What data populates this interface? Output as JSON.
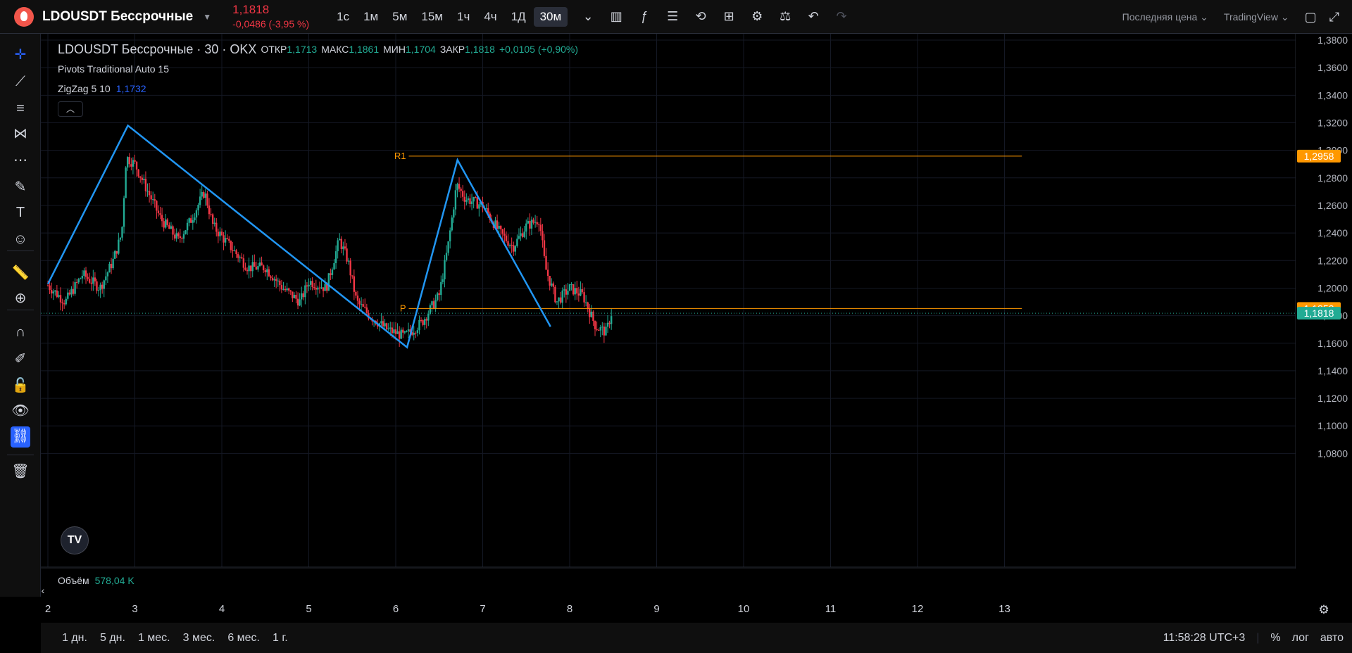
{
  "header": {
    "symbol": "LDOUSDT Бессрочные",
    "last_price": "1,1818",
    "change": "-0,0486 (-3,95 %)",
    "intervals": [
      "1с",
      "1м",
      "5м",
      "15м",
      "1ч",
      "4ч",
      "1Д",
      "30м"
    ],
    "active_interval": "30м",
    "price_type": "Последняя цена",
    "brand": "TradingView"
  },
  "legend": {
    "symbol": "LDOUSDT Бессрочные · 30 · OKX",
    "open_label": "ОТКР",
    "open": "1,1713",
    "high_label": "МАКС",
    "high": "1,1861",
    "low_label": "МИН",
    "low": "1,1704",
    "close_label": "ЗАКР",
    "close": "1,1818",
    "change": "+0,0105 (+0,90%)",
    "pivots": "Pivots Traditional Auto 15",
    "zigzag": "ZigZag 5 10",
    "zigzag_value": "1,1732"
  },
  "volume": {
    "label": "Объём",
    "value": "578,04 K"
  },
  "pivots": {
    "r1": "R1",
    "p": "P",
    "r1_value": "1,2958",
    "p_value": "1,1852",
    "current_value": "1,1818"
  },
  "price_axis": [
    "1,3800",
    "1,3600",
    "1,3400",
    "1,3200",
    "1,3000",
    "1,2800",
    "1,2600",
    "1,2400",
    "1,2200",
    "1,2000",
    "1,1800",
    "1,1600",
    "1,1400",
    "1,1200",
    "1,1000",
    "1,0800"
  ],
  "time_axis": [
    "2",
    "3",
    "4",
    "5",
    "6",
    "7",
    "8",
    "9",
    "10",
    "11",
    "12",
    "13"
  ],
  "ranges": [
    "1 дн.",
    "5 дн.",
    "1 мес.",
    "3 мес.",
    "6 мес.",
    "1 г."
  ],
  "status": {
    "clock": "11:58:28 UTC+3",
    "percent": "%",
    "log": "лог",
    "auto": "авто"
  },
  "colors": {
    "up": "#22ab94",
    "down": "#f23645",
    "zigzag": "#2196f3",
    "pivot": "#ff9800",
    "current": "#22ab94",
    "accent": "#2962ff"
  },
  "chart_data": {
    "type": "candlestick",
    "title": "LDOUSDT Бессрочные · 30 · OKX",
    "ylim": [
      1.07,
      1.39
    ],
    "xlim": [
      2,
      13.7
    ],
    "zigzag": [
      [
        2.0,
        1.203
      ],
      [
        2.92,
        1.318
      ],
      [
        6.13,
        1.157
      ],
      [
        6.71,
        1.293
      ],
      [
        7.78,
        1.172
      ]
    ],
    "pivot_levels": {
      "R1": 1.2958,
      "P": 1.1852
    },
    "current_price": 1.1818,
    "close_path": [
      [
        2.0,
        1.202
      ],
      [
        2.2,
        1.19
      ],
      [
        2.4,
        1.21
      ],
      [
        2.6,
        1.2
      ],
      [
        2.75,
        1.22
      ],
      [
        2.85,
        1.24
      ],
      [
        2.9,
        1.295
      ],
      [
        3.0,
        1.29
      ],
      [
        3.15,
        1.27
      ],
      [
        3.3,
        1.25
      ],
      [
        3.5,
        1.235
      ],
      [
        3.65,
        1.25
      ],
      [
        3.8,
        1.27
      ],
      [
        3.9,
        1.245
      ],
      [
        4.1,
        1.23
      ],
      [
        4.3,
        1.215
      ],
      [
        4.5,
        1.215
      ],
      [
        4.7,
        1.2
      ],
      [
        4.9,
        1.19
      ],
      [
        5.0,
        1.205
      ],
      [
        5.2,
        1.2
      ],
      [
        5.35,
        1.235
      ],
      [
        5.45,
        1.22
      ],
      [
        5.55,
        1.19
      ],
      [
        5.7,
        1.18
      ],
      [
        5.9,
        1.17
      ],
      [
        6.1,
        1.165
      ],
      [
        6.3,
        1.175
      ],
      [
        6.5,
        1.195
      ],
      [
        6.6,
        1.23
      ],
      [
        6.7,
        1.275
      ],
      [
        6.8,
        1.265
      ],
      [
        7.0,
        1.26
      ],
      [
        7.2,
        1.24
      ],
      [
        7.35,
        1.23
      ],
      [
        7.5,
        1.245
      ],
      [
        7.65,
        1.25
      ],
      [
        7.72,
        1.215
      ],
      [
        7.85,
        1.19
      ],
      [
        8.0,
        1.2
      ],
      [
        8.15,
        1.195
      ],
      [
        8.3,
        1.172
      ],
      [
        8.42,
        1.168
      ],
      [
        8.48,
        1.1818
      ]
    ]
  }
}
